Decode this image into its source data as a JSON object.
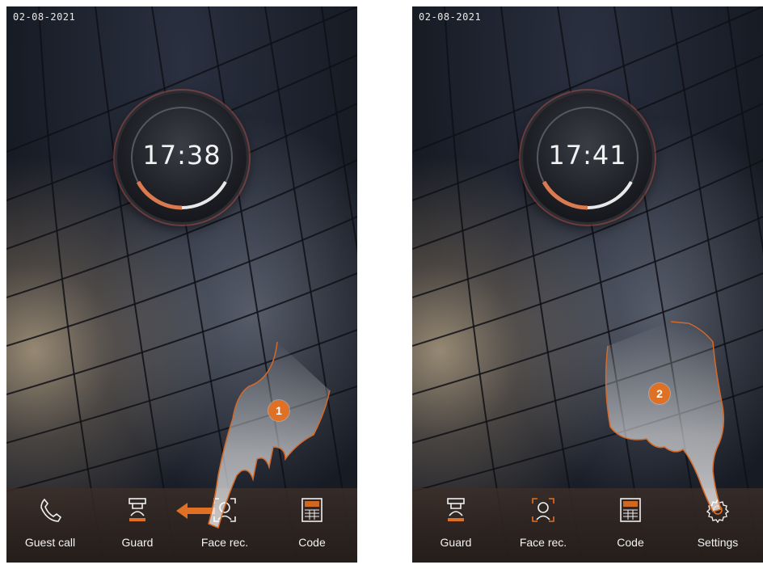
{
  "colors": {
    "accent": "#e07024",
    "hand_outline": "#d4692a",
    "label": "#f3f3f3"
  },
  "screens": [
    {
      "date": "02-08-2021",
      "time": "17:38",
      "step": "1",
      "dock": [
        {
          "label": "Guest call",
          "icon": "phone-icon"
        },
        {
          "label": "Guard",
          "icon": "guard-icon"
        },
        {
          "label": "Face rec.",
          "icon": "face-recognition-icon"
        },
        {
          "label": "Code",
          "icon": "keypad-icon"
        }
      ],
      "gesture": "swipe-left"
    },
    {
      "date": "02-08-2021",
      "time": "17:41",
      "step": "2",
      "dock": [
        {
          "label": "Guard",
          "icon": "guard-icon"
        },
        {
          "label": "Face rec.",
          "icon": "face-recognition-icon"
        },
        {
          "label": "Code",
          "icon": "keypad-icon"
        },
        {
          "label": "Settings",
          "icon": "gear-icon"
        }
      ],
      "gesture": "tap"
    }
  ]
}
